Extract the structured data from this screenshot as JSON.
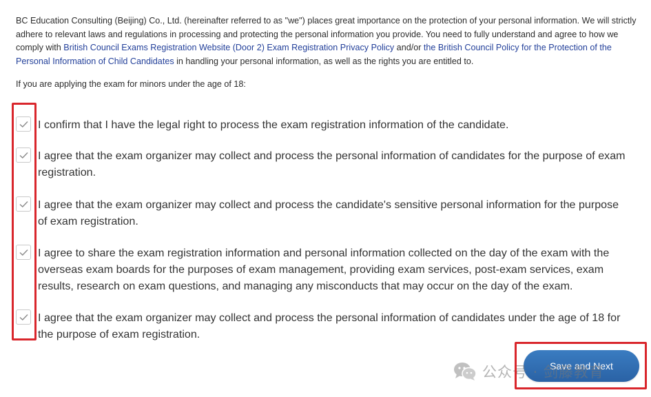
{
  "intro": {
    "text_1": "BC Education Consulting (Beijing) Co., Ltd. (hereinafter referred to as \"we\") places great importance on the protection of your personal information. We will strictly adhere to relevant laws and regulations in processing and protecting the personal information you provide. You need to fully understand and agree to how we comply with ",
    "link_1": "British Council Exams Registration Website (Door 2) Exam Registration Privacy Policy",
    "text_2": " and/or ",
    "link_2": "the British Council Policy for the Protection of the Personal Information of Child Candidates",
    "text_3": " in handling your personal information, as well as the rights you are entitled to."
  },
  "minors_note": "If you are applying the exam for minors under the age of 18:",
  "consents": [
    {
      "checked": true,
      "text": "I confirm that I have the legal right to process the exam registration information of the candidate."
    },
    {
      "checked": true,
      "text": "I agree that the exam organizer may collect and process the personal information of candidates for the purpose of exam registration."
    },
    {
      "checked": true,
      "text": "I agree that the exam organizer may collect and process the candidate's sensitive personal information for the purpose of exam registration."
    },
    {
      "checked": true,
      "text": "I agree to share the exam registration information and personal information collected on the day of the exam with the overseas exam boards for the purposes of exam management, providing exam services, post-exam services, exam results, research on exam questions, and managing any misconducts that may occur on the day of the exam."
    },
    {
      "checked": true,
      "text": "I agree that the exam organizer may collect and process the personal information of candidates under the age of 18 for the purpose of exam registration."
    }
  ],
  "save_button_label": "Save and Next",
  "watermark": {
    "icon": "wechat-icon",
    "text": "公众号 · 剑藤教育"
  },
  "colors": {
    "link": "#23409a",
    "highlight": "#d9262c",
    "button": "#2b6cb0",
    "check": "#8a8a8a"
  }
}
